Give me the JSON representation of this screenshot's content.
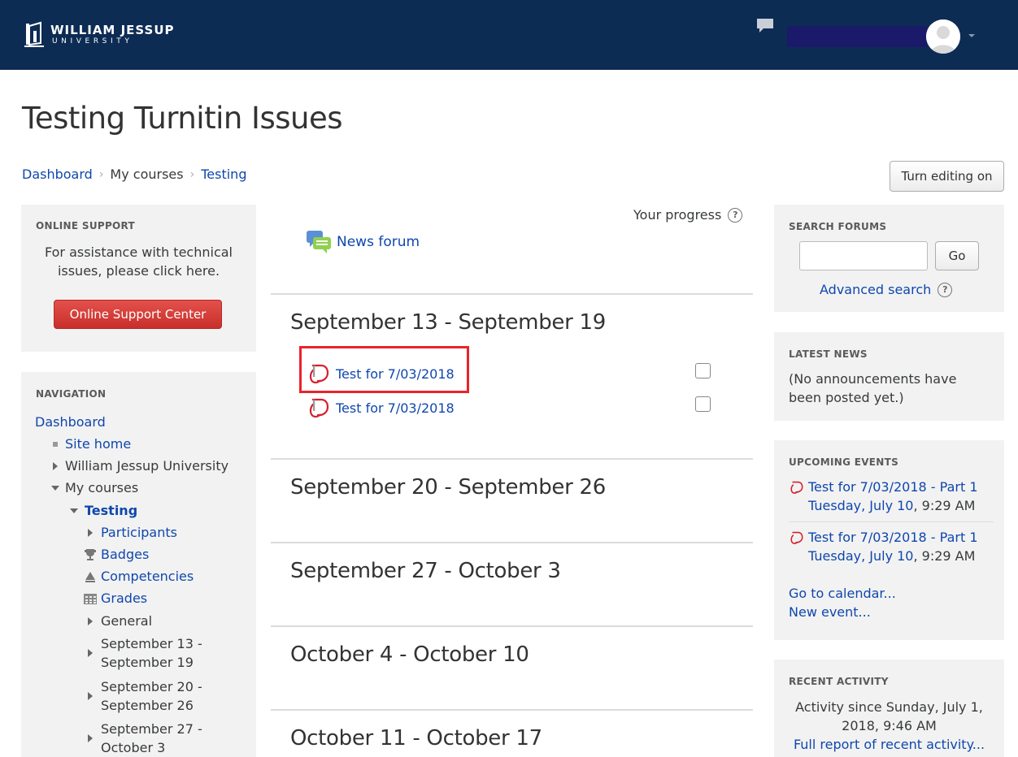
{
  "header": {
    "logo_line1": "WILLIAM JESSUP",
    "logo_line2": "UNIVERSITY"
  },
  "page": {
    "title": "Testing Turnitin Issues"
  },
  "breadcrumb": {
    "items": [
      "Dashboard",
      "My courses",
      "Testing"
    ]
  },
  "actions": {
    "edit_label": "Turn editing on"
  },
  "support_block": {
    "title": "ONLINE SUPPORT",
    "description": "For assistance with technical issues, please click here.",
    "button_label": "Online Support Center",
    "button_color": "#d9433e"
  },
  "navigation": {
    "title": "NAVIGATION",
    "items": [
      "Dashboard",
      "Site home",
      "William Jessup University",
      "My courses",
      "Testing",
      "Participants",
      "Badges",
      "Competencies",
      "Grades",
      "General",
      "September 13 -",
      "September 19",
      "September 20 -",
      "September 26",
      "September 27 -",
      "October 3"
    ]
  },
  "course": {
    "progress_label": "Your progress",
    "forum_label": "News forum",
    "sections": [
      {
        "title": "September 13 - September 19",
        "activities": [
          "Test for 7/03/2018",
          "Test for 7/03/2018"
        ]
      },
      {
        "title": "September 20 - September 26"
      },
      {
        "title": "September 27 - October 3"
      },
      {
        "title": "October 4 - October 10"
      },
      {
        "title": "October 11 - October 17"
      }
    ],
    "highlight_color": "#e8242a"
  },
  "search_forums": {
    "title": "SEARCH FORUMS",
    "input_value": "",
    "go_label": "Go",
    "advanced_label": "Advanced search"
  },
  "latest_news": {
    "title": "LATEST NEWS",
    "text": "(No announcements have been posted yet.)"
  },
  "upcoming_events": {
    "title": "UPCOMING EVENTS",
    "events": [
      {
        "name": "Test for 7/03/2018 - Part 1",
        "date": "Tuesday, July 10",
        "time": ", 9:29 AM"
      },
      {
        "name": "Test for 7/03/2018 - Part 1",
        "date": "Tuesday, July 10",
        "time": ", 9:29 AM"
      }
    ],
    "calendar_link": "Go to calendar...",
    "new_event_link": "New event..."
  },
  "recent_activity": {
    "title": "RECENT ACTIVITY",
    "text": "Activity since Sunday, July 1, 2018, 9:46 AM",
    "report_link": "Full report of recent activity..."
  },
  "icons": {
    "message": "speech-bubble-icon",
    "help": "question-circle-icon",
    "forum": "forum-icon",
    "turnitin": "turnitin-icon",
    "badge": "trophy-icon",
    "competency": "triangle-icon",
    "grades": "table-icon"
  },
  "colors": {
    "navbar": "#0d2c54",
    "link": "#0f47ad"
  }
}
